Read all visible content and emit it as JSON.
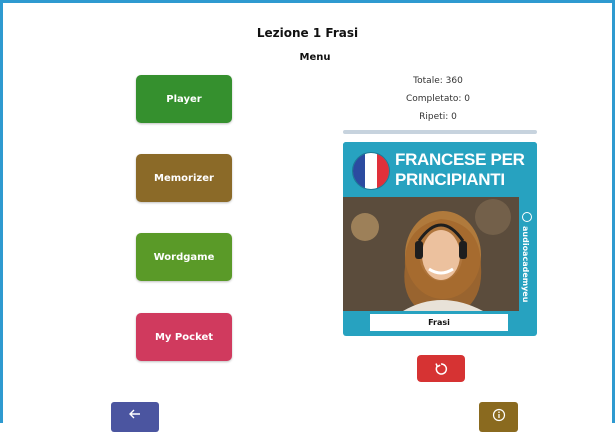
{
  "header": {
    "title": "Lezione 1 Frasi",
    "subtitle": "Menu"
  },
  "menu": {
    "items": [
      {
        "label": "Player",
        "color": "#35902e"
      },
      {
        "label": "Memorizer",
        "color": "#8b6a28"
      },
      {
        "label": "Wordgame",
        "color": "#5a9a28"
      },
      {
        "label": "My Pocket",
        "color": "#d03a5e"
      }
    ]
  },
  "stats": {
    "total": "Totale: 360",
    "completed": "Completato: 0",
    "repeats": "Ripeti: 0",
    "progress_fraction": 0
  },
  "cover": {
    "title": "FRANCESE PER PRINCIPIANTI",
    "side_text": "audioacademyeu",
    "label": "Frasi",
    "background": "#27a2c0"
  },
  "buttons": {
    "reset_icon": "refresh-icon",
    "reset_color": "#d63333",
    "back_icon": "arrow-left-icon",
    "back_color": "#4b55a0",
    "info_icon": "info-icon",
    "info_color": "#8a6a1f"
  }
}
